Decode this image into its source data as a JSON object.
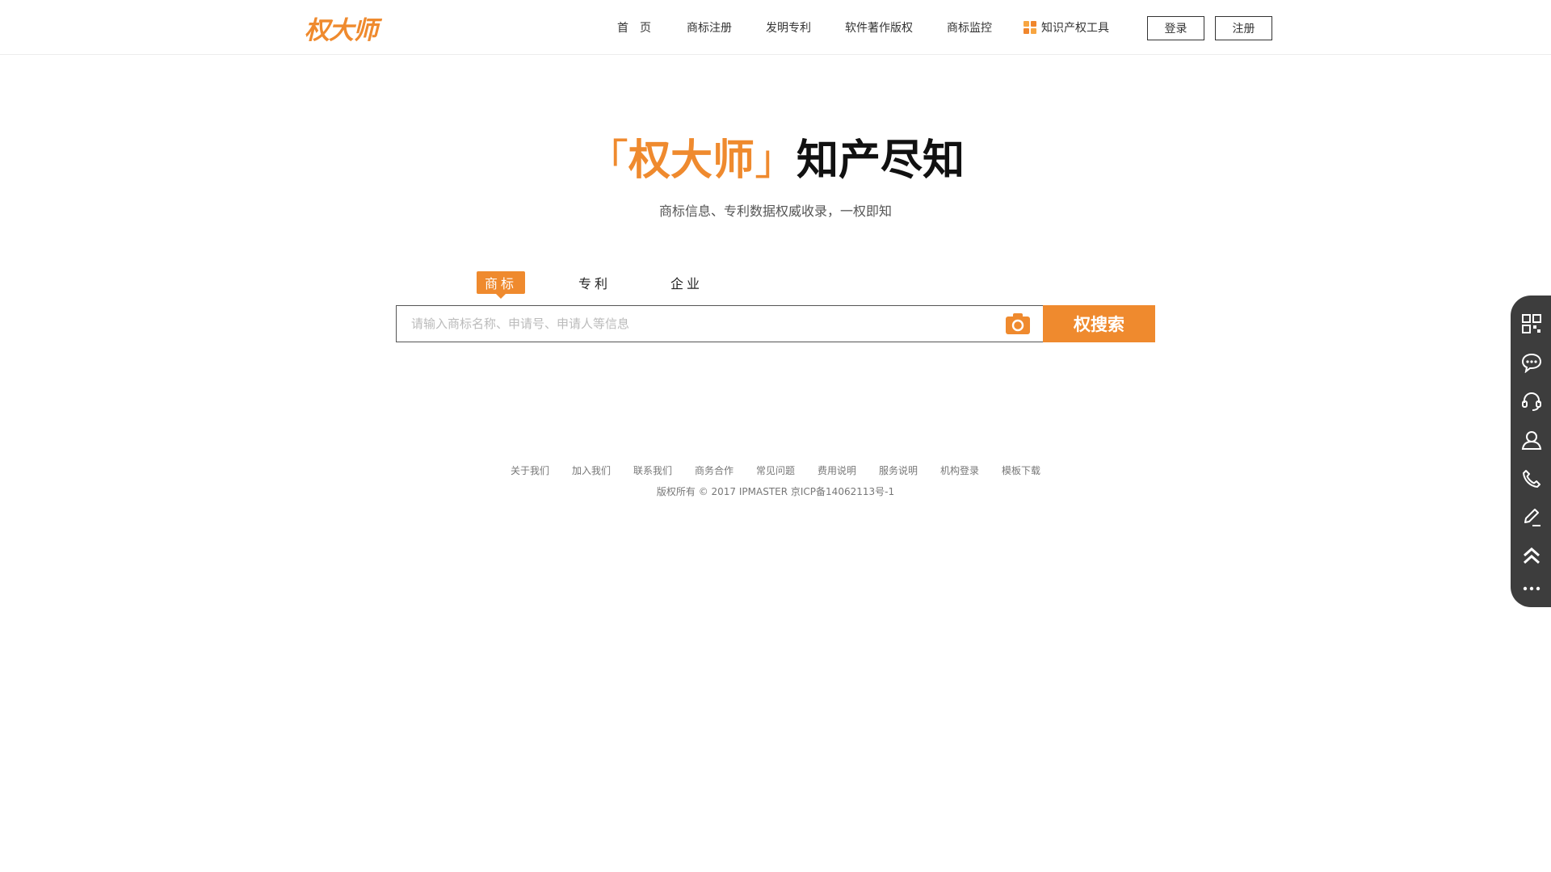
{
  "header": {
    "logo_text": "权大师",
    "nav": [
      {
        "label": "首　页"
      },
      {
        "label": "商标注册"
      },
      {
        "label": "发明专利"
      },
      {
        "label": "软件著作版权"
      },
      {
        "label": "商标监控"
      },
      {
        "label": "知识产权工具",
        "icon": "grid-squares-icon"
      }
    ],
    "login_label": "登录",
    "register_label": "注册"
  },
  "hero": {
    "bracket_open": "「",
    "brand": "权大师",
    "bracket_close": "」",
    "slogan": "知产尽知",
    "subtitle": "商标信息、专利数据权威收录，一权即知"
  },
  "search": {
    "tabs": [
      {
        "label": "商标",
        "active": true
      },
      {
        "label": "专利",
        "active": false
      },
      {
        "label": "企业",
        "active": false
      }
    ],
    "placeholder": "请输入商标名称、申请号、申请人等信息",
    "value": "",
    "button_label": "权搜索",
    "image_search_icon": "camera-icon"
  },
  "footer": {
    "links": [
      "关于我们",
      "加入我们",
      "联系我们",
      "商务合作",
      "常见问题",
      "费用说明",
      "服务说明",
      "机构登录",
      "模板下载"
    ],
    "copyright": "版权所有 © 2017 IPMASTER 京ICP备14062113号-1"
  },
  "side_toolbar": {
    "icons": [
      "qrcode-icon",
      "chat-bubble-icon",
      "headset-icon",
      "user-icon",
      "phone-icon",
      "edit-pen-icon",
      "back-to-top-icon",
      "more-dots-icon"
    ]
  },
  "colors": {
    "accent": "#ef8a2e",
    "side_toolbar_bg": "#3d3d3d",
    "text": "#333333"
  }
}
